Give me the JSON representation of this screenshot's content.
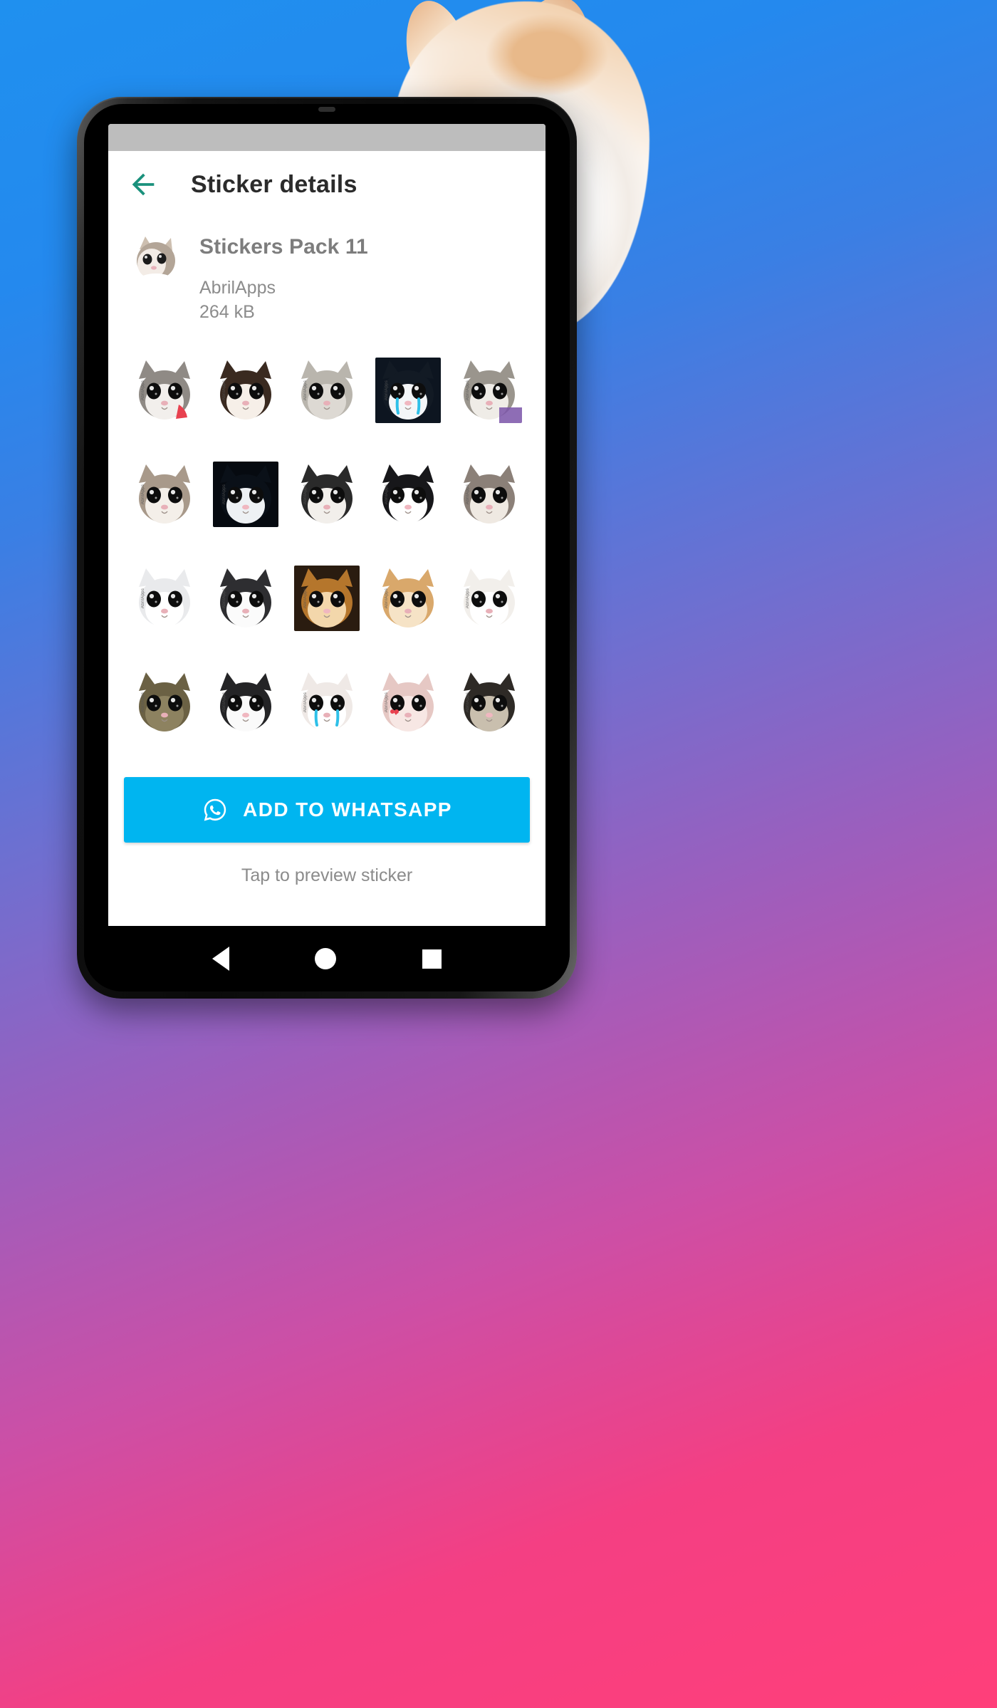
{
  "background": {
    "gradient_colors": [
      "#1f90ef",
      "#6f6fd0",
      "#cc4fa6",
      "#ff3f7a"
    ]
  },
  "decoration": {
    "cat_cutout": "crying-cat-cutout-image"
  },
  "phone": {
    "statusbar": {
      "color": "#bdbdbd"
    },
    "navbar": {
      "back": "nav-back-triangle",
      "home": "nav-home-circle",
      "recents": "nav-recents-square"
    }
  },
  "appbar": {
    "back_icon": "arrow-left-icon",
    "back_icon_color": "#1a917c",
    "title": "Sticker details"
  },
  "pack": {
    "thumbnail": "sticker-pack-thumbnail",
    "name": "Stickers Pack 11",
    "author": "AbrilApps",
    "size": "264 kB"
  },
  "stickers": {
    "watermark": "AbrilApps",
    "items": [
      {
        "name": "sticker-1",
        "alt": "grey and white kitten with red object"
      },
      {
        "name": "sticker-2",
        "alt": "dark brown kitten big eyes"
      },
      {
        "name": "sticker-3",
        "alt": "grey cat big black eyes"
      },
      {
        "name": "sticker-4",
        "alt": "black and white cat with blue tears"
      },
      {
        "name": "sticker-5",
        "alt": "grey kitten on purple blanket"
      },
      {
        "name": "sticker-6",
        "alt": "brown and white kitten"
      },
      {
        "name": "sticker-7",
        "alt": "black cat white chest dark background"
      },
      {
        "name": "sticker-8",
        "alt": "tuxedo cat face closeup"
      },
      {
        "name": "sticker-9",
        "alt": "black cat white muzzle"
      },
      {
        "name": "sticker-10",
        "alt": "grey tabby kitten sad eyes"
      },
      {
        "name": "sticker-11",
        "alt": "white cat head turned"
      },
      {
        "name": "sticker-12",
        "alt": "fluffy black and white cat"
      },
      {
        "name": "sticker-13",
        "alt": "orange cat warm light"
      },
      {
        "name": "sticker-14",
        "alt": "ginger kitten big eyes"
      },
      {
        "name": "sticker-15",
        "alt": "white cat blue eyes"
      },
      {
        "name": "sticker-16",
        "alt": "brown cat looking up"
      },
      {
        "name": "sticker-17",
        "alt": "black and white cat closeup"
      },
      {
        "name": "sticker-18",
        "alt": "white cat with blue tear streak"
      },
      {
        "name": "sticker-19",
        "alt": "pink tinted cat with red heart"
      },
      {
        "name": "sticker-20",
        "alt": "dark kitten shiny eyes"
      }
    ]
  },
  "cta": {
    "icon": "whatsapp-icon",
    "label": "ADD TO WHATSAPP",
    "color": "#00b5f0"
  },
  "hint": {
    "text": "Tap to preview sticker"
  }
}
